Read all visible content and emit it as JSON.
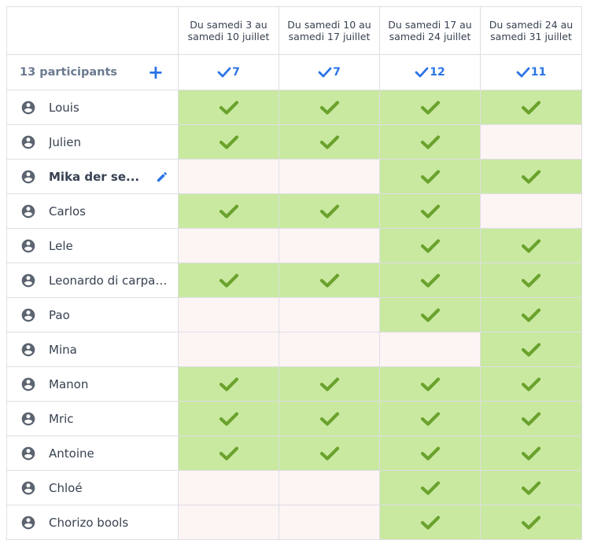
{
  "columns": [
    {
      "label": "Du samedi 3 au samedi 10 juillet",
      "total": "7"
    },
    {
      "label": "Du samedi 10 au samedi 17 juillet",
      "total": "7"
    },
    {
      "label": "Du samedi 17 au samedi 24 juillet",
      "total": "12"
    },
    {
      "label": "Du samedi 24 au samedi 31 juillet",
      "total": "11"
    }
  ],
  "summary": {
    "participants_label": "13 participants",
    "add_icon": "plus-icon"
  },
  "participants": [
    {
      "name": "Louis",
      "votes": [
        true,
        true,
        true,
        true
      ]
    },
    {
      "name": "Julien",
      "votes": [
        true,
        true,
        true,
        false
      ]
    },
    {
      "name": "Mika der se...",
      "votes": [
        false,
        false,
        true,
        true
      ],
      "current_user": true
    },
    {
      "name": "Carlos",
      "votes": [
        true,
        true,
        true,
        false
      ]
    },
    {
      "name": "Lele",
      "votes": [
        false,
        false,
        true,
        true
      ]
    },
    {
      "name": "Leonardo di carpac...",
      "votes": [
        true,
        true,
        true,
        true
      ]
    },
    {
      "name": "Pao",
      "votes": [
        false,
        false,
        true,
        true
      ]
    },
    {
      "name": "Mina",
      "votes": [
        false,
        false,
        false,
        true
      ]
    },
    {
      "name": "Manon",
      "votes": [
        true,
        true,
        true,
        true
      ]
    },
    {
      "name": "Mric",
      "votes": [
        true,
        true,
        true,
        true
      ]
    },
    {
      "name": "Antoine",
      "votes": [
        true,
        true,
        true,
        true
      ]
    },
    {
      "name": "Chloé",
      "votes": [
        false,
        false,
        true,
        true
      ]
    },
    {
      "name": "Chorizo bools",
      "votes": [
        false,
        false,
        true,
        true
      ]
    }
  ],
  "colors": {
    "yes_bg": "#c9e9a0",
    "no_bg": "#fdf4f4",
    "check": "#6aa22d",
    "accent": "#2b74e6",
    "avatar": "#5c6470"
  }
}
